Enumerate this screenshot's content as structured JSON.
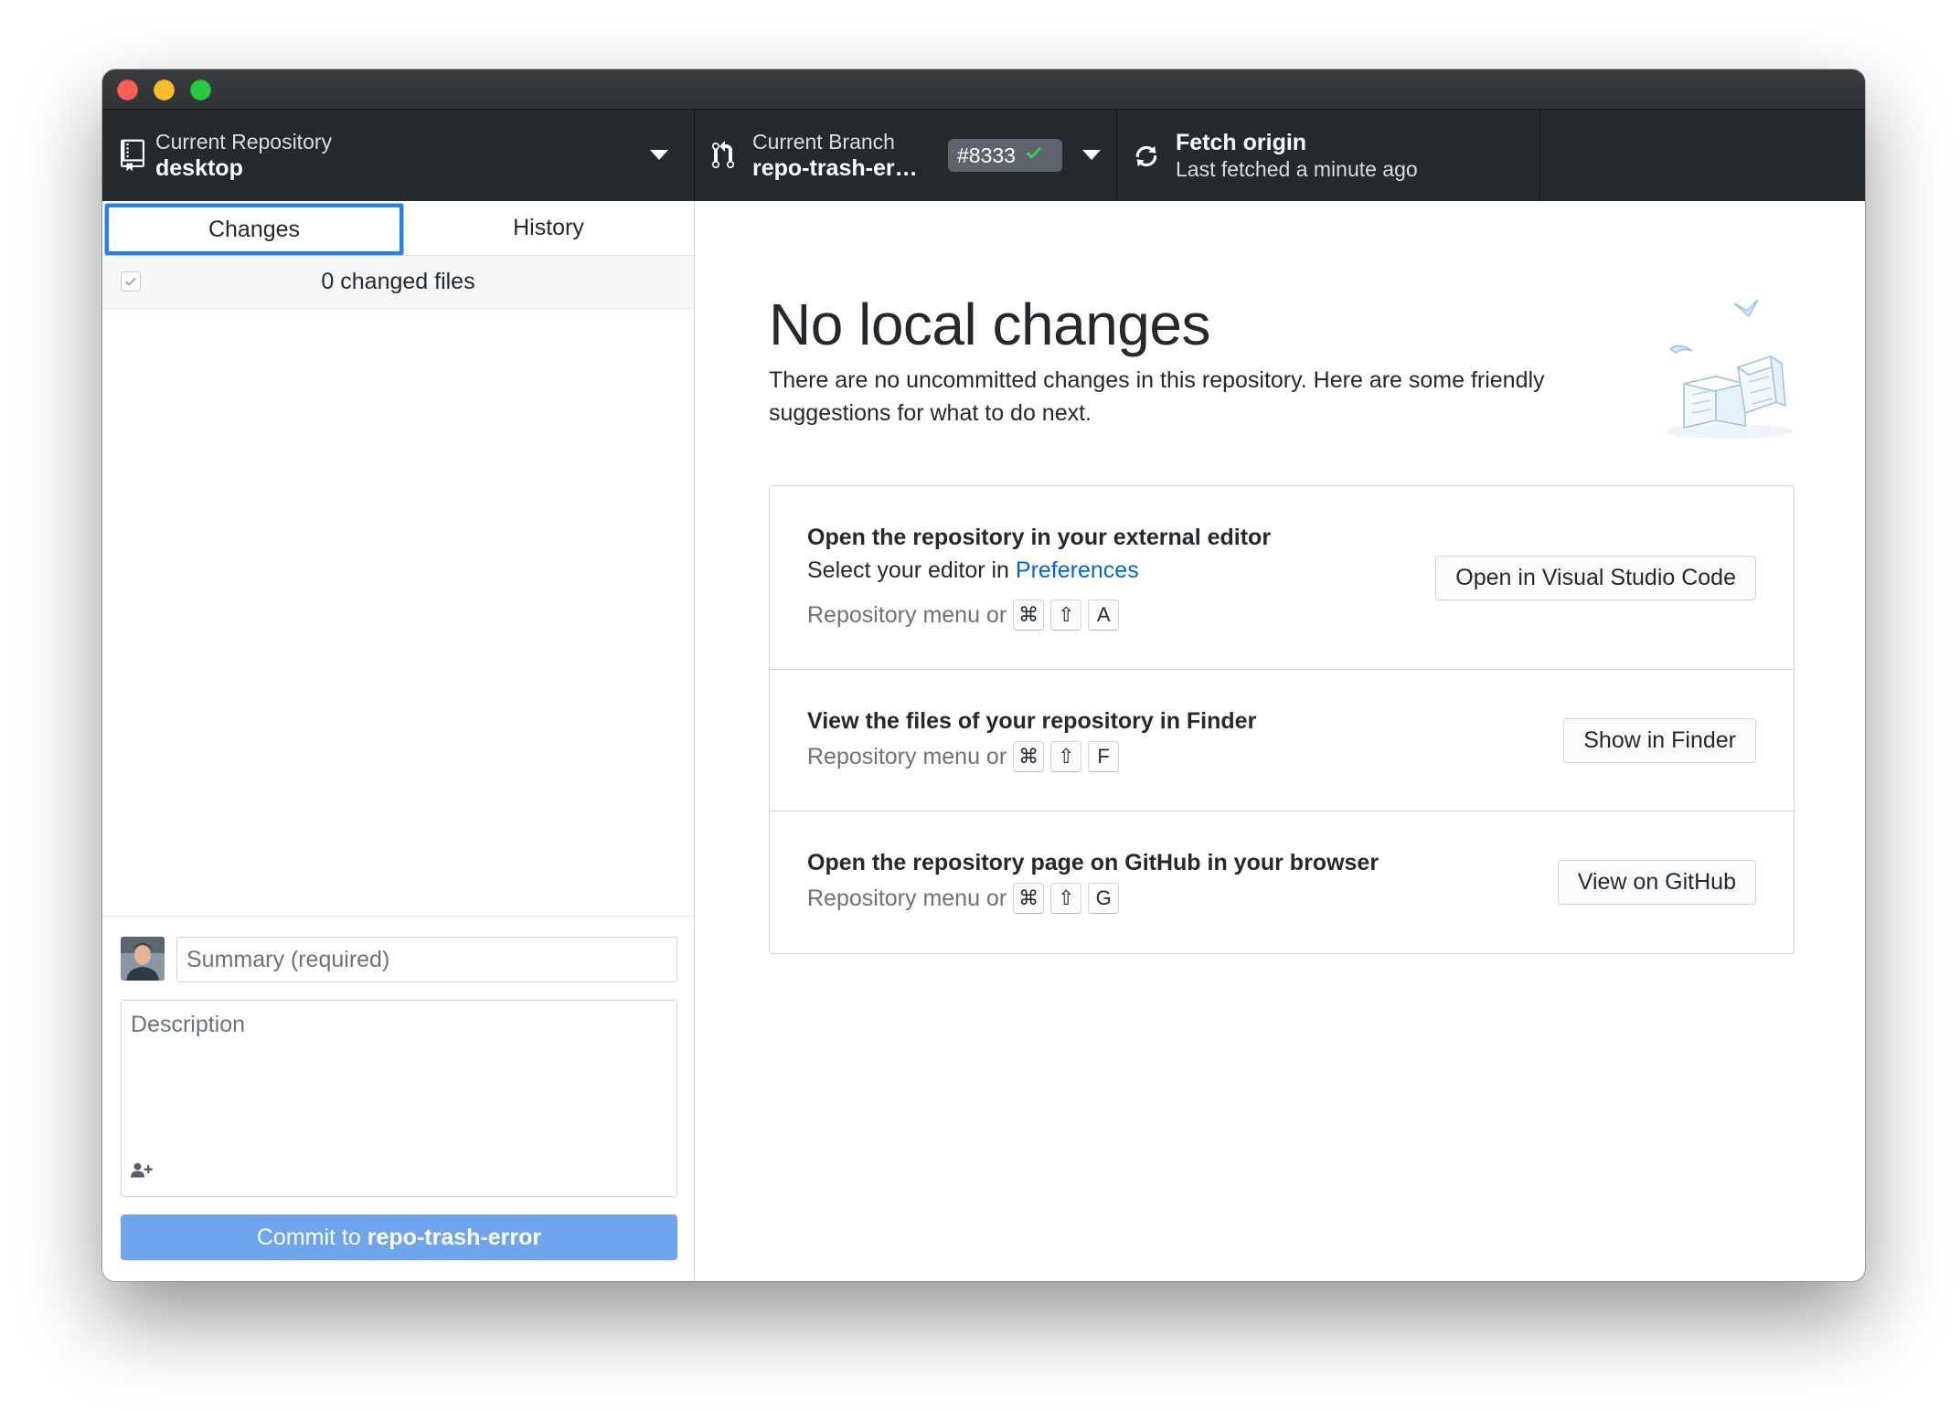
{
  "toolbar": {
    "repository": {
      "label": "Current Repository",
      "value": "desktop"
    },
    "branch": {
      "label": "Current Branch",
      "value": "repo-trash-er…",
      "pr_badge": "#8333"
    },
    "fetch": {
      "label": "Fetch origin",
      "status": "Last fetched a minute ago"
    }
  },
  "sidebar": {
    "tabs": [
      {
        "label": "Changes",
        "selected": true
      },
      {
        "label": "History",
        "selected": false
      }
    ],
    "changes_count": "0 changed files",
    "commit": {
      "summary_placeholder": "Summary (required)",
      "description_placeholder": "Description",
      "button_prefix": "Commit to",
      "button_branch": "repo-trash-error"
    }
  },
  "main": {
    "title": "No local changes",
    "text": "There are no uncommitted changes in this repository. Here are some friendly suggestions for what to do next.",
    "actions": [
      {
        "title": "Open the repository in your external editor",
        "subtitle_prefix": "Select your editor in",
        "subtitle_link": "Preferences",
        "shortcut_prefix": "Repository menu or",
        "keys": [
          "⌘",
          "⇧",
          "A"
        ],
        "button": "Open in Visual Studio Code"
      },
      {
        "title": "View the files of your repository in Finder",
        "shortcut_prefix": "Repository menu or",
        "keys": [
          "⌘",
          "⇧",
          "F"
        ],
        "button": "Show in Finder"
      },
      {
        "title": "Open the repository page on GitHub in your browser",
        "shortcut_prefix": "Repository menu or",
        "keys": [
          "⌘",
          "⇧",
          "G"
        ],
        "button": "View on GitHub"
      }
    ]
  },
  "icons": {
    "repo": "repo-icon",
    "branch": "git-branch-icon",
    "fetch": "sync-icon",
    "check": "check-icon",
    "coauthor": "person-add-icon",
    "illustration": "boxes-illustration"
  },
  "colors": {
    "toolbar_bg": "#24292e",
    "accent": "#2e7de1",
    "link": "#0366d6",
    "commit_button": "#6fa5ec",
    "check_green": "#28a745"
  }
}
